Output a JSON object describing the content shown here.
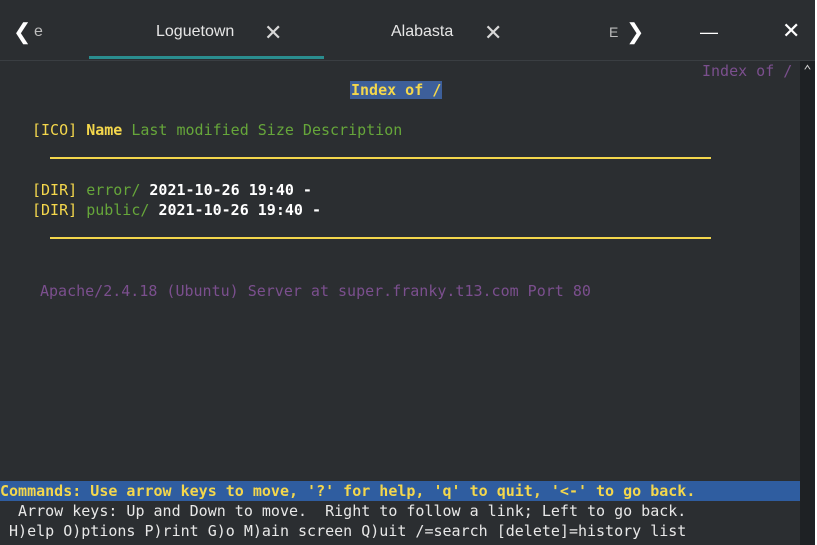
{
  "tabs": {
    "prev_partial": "e",
    "active": "Loguetown",
    "second": "Alabasta",
    "next_partial": "E"
  },
  "window": {
    "minimize": "—",
    "close": "✕"
  },
  "terminal": {
    "corner_title": "Index of /",
    "page_title": "Index of /",
    "header": {
      "ico": "[ICO]",
      "name": "Name",
      "rest": "Last modified Size Description"
    },
    "rows": [
      {
        "tag": "[DIR]",
        "name": "error/",
        "info": "2021-10-26 19:40 -"
      },
      {
        "tag": "[DIR]",
        "name": "public/",
        "info": "2021-10-26 19:40 -"
      }
    ],
    "footer": "Apache/2.4.18 (Ubuntu) Server at super.franky.t13.com Port 80",
    "status_line": "Commands: Use arrow keys to move, '?' for help, 'q' to quit, '<-' to go back.",
    "help_line_1": "  Arrow keys: Up and Down to move.  Right to follow a link; Left to go back.",
    "help_line_2": " H)elp O)ptions P)rint G)o M)ain screen Q)uit /=search [delete]=history list"
  }
}
